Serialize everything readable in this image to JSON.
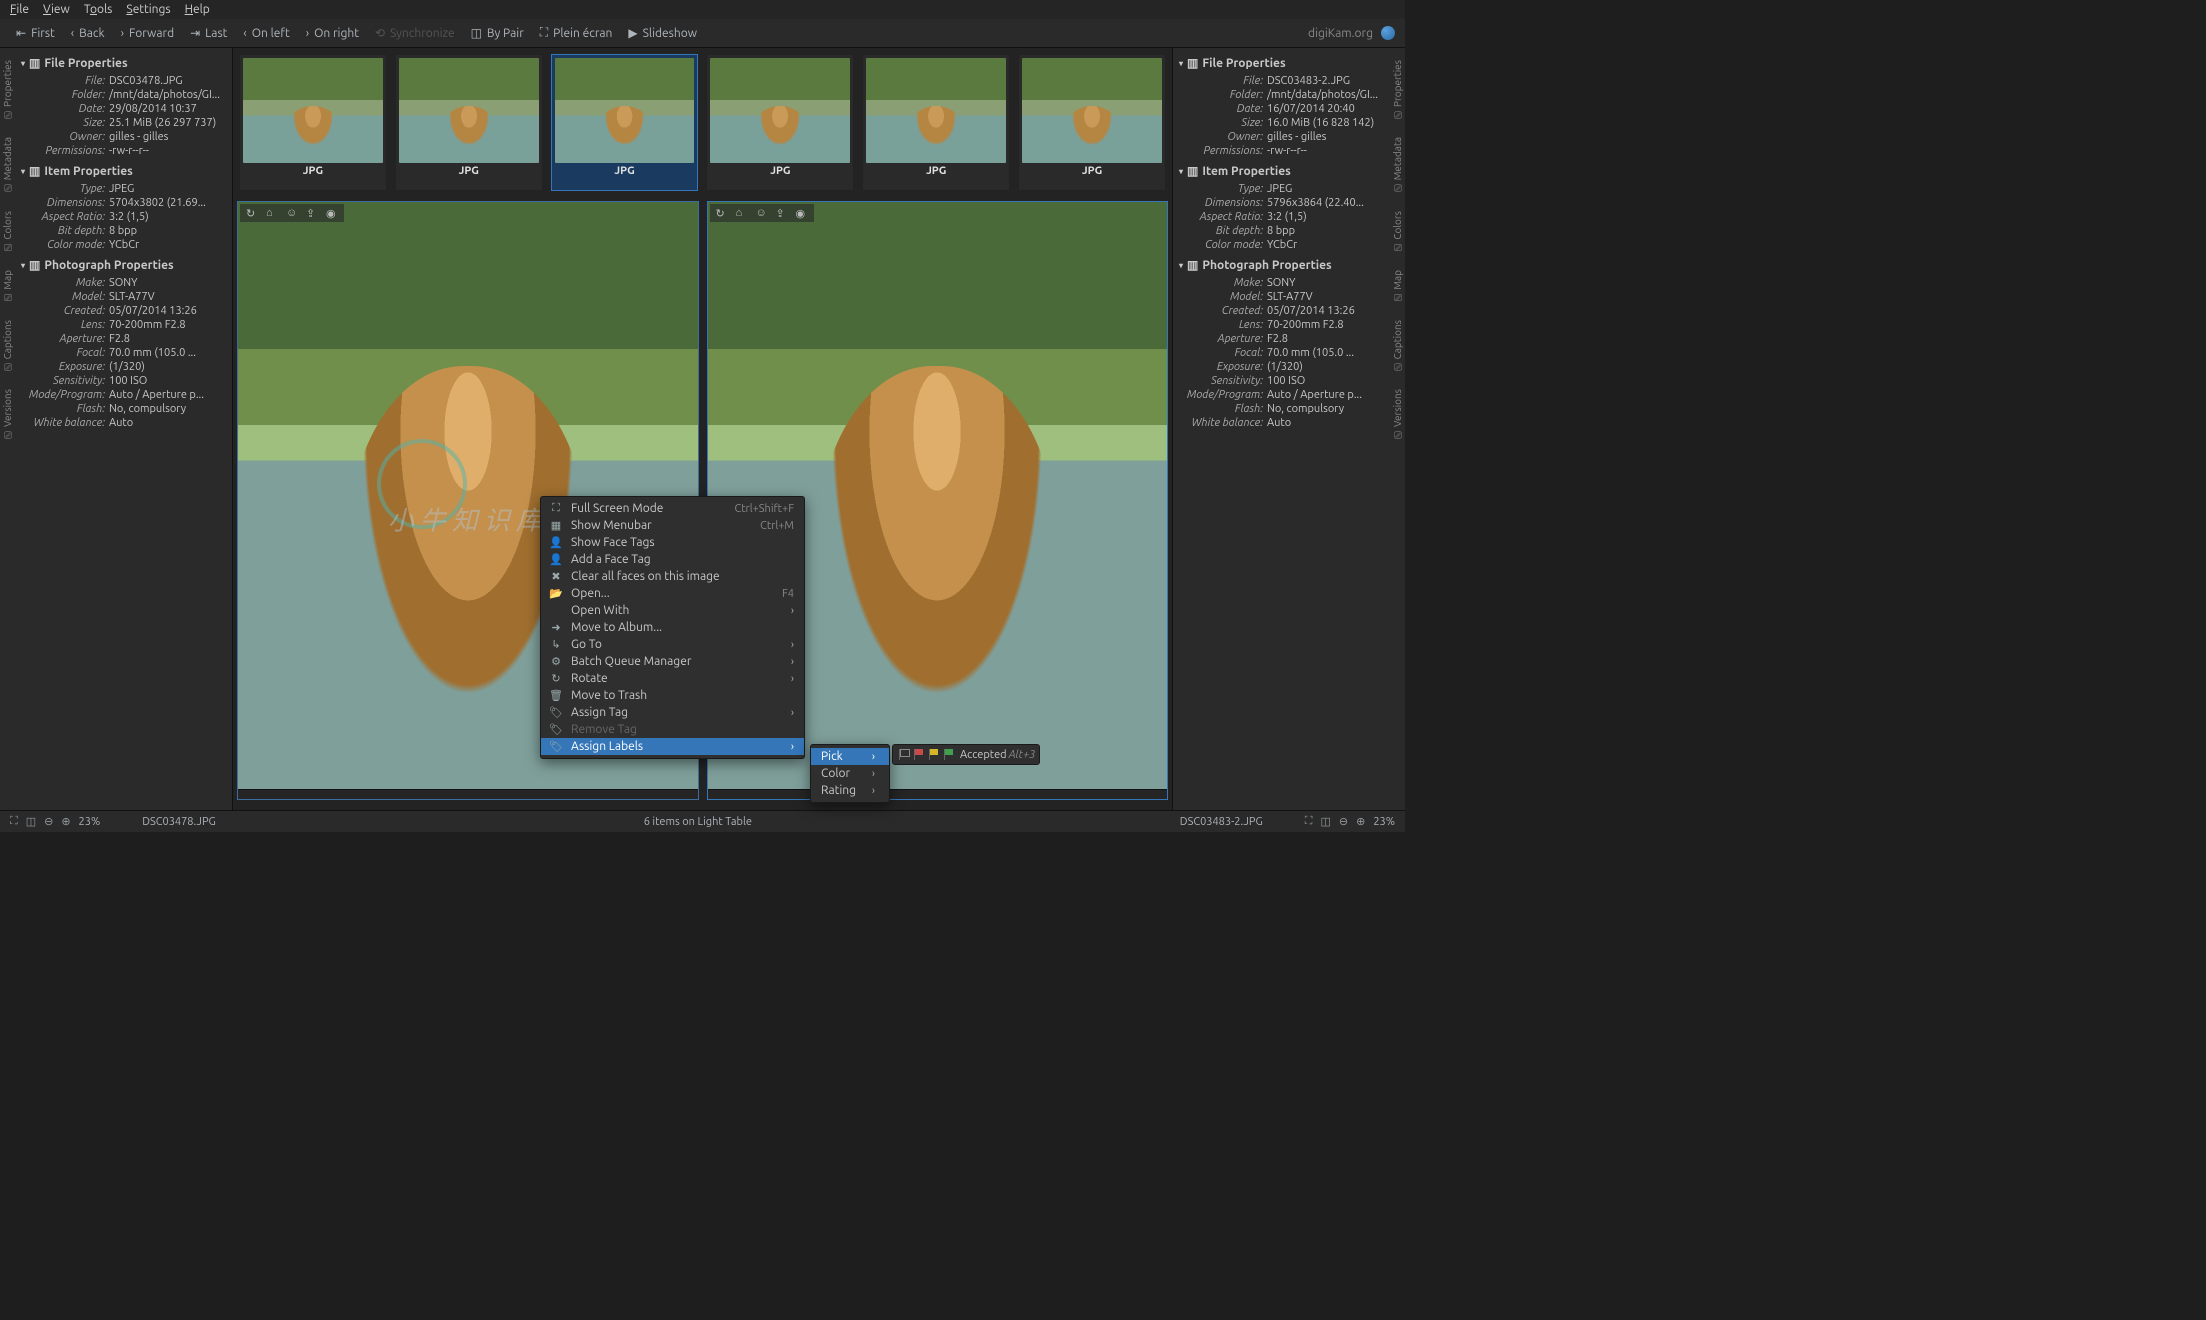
{
  "menubar": {
    "file": "File",
    "view": "View",
    "tools": "Tools",
    "settings": "Settings",
    "help": "Help"
  },
  "toolbar": {
    "first": "First",
    "back": "Back",
    "forward": "Forward",
    "last": "Last",
    "onleft": "On left",
    "onright": "On right",
    "sync": "Synchronize",
    "bypair": "By Pair",
    "fullscreen": "Plein écran",
    "slideshow": "Slideshow",
    "brand": "digiKam.org"
  },
  "thumbnails": {
    "label": "JPG",
    "count": 6
  },
  "left_panel": {
    "file_props": {
      "header": "File Properties",
      "rows": [
        {
          "k": "File:",
          "v": "DSC03478.JPG"
        },
        {
          "k": "Folder:",
          "v": "/mnt/data/photos/GI..."
        },
        {
          "k": "Date:",
          "v": "29/08/2014 10:37"
        },
        {
          "k": "Size:",
          "v": "25.1 MiB (26 297 737)"
        },
        {
          "k": "Owner:",
          "v": "gilles - gilles"
        },
        {
          "k": "Permissions:",
          "v": "-rw-r--r--"
        }
      ]
    },
    "item_props": {
      "header": "Item Properties",
      "rows": [
        {
          "k": "Type:",
          "v": "JPEG"
        },
        {
          "k": "Dimensions:",
          "v": "5704x3802 (21.69..."
        },
        {
          "k": "Aspect Ratio:",
          "v": "3:2 (1,5)"
        },
        {
          "k": "Bit depth:",
          "v": "8 bpp"
        },
        {
          "k": "Color mode:",
          "v": "YCbCr"
        }
      ]
    },
    "photo_props": {
      "header": "Photograph Properties",
      "rows": [
        {
          "k": "Make:",
          "v": "SONY"
        },
        {
          "k": "Model:",
          "v": "SLT-A77V"
        },
        {
          "k": "Created:",
          "v": "05/07/2014 13:26"
        },
        {
          "k": "Lens:",
          "v": "70-200mm F2.8"
        },
        {
          "k": "Aperture:",
          "v": "F2.8"
        },
        {
          "k": "Focal:",
          "v": "70.0 mm (105.0 ..."
        },
        {
          "k": "Exposure:",
          "v": "(1/320)"
        },
        {
          "k": "Sensitivity:",
          "v": "100 ISO"
        },
        {
          "k": "Mode/Program:",
          "v": "Auto / Aperture p..."
        },
        {
          "k": "Flash:",
          "v": "No, compulsory"
        },
        {
          "k": "White balance:",
          "v": "Auto"
        }
      ]
    }
  },
  "right_panel": {
    "file_props": {
      "header": "File Properties",
      "rows": [
        {
          "k": "File:",
          "v": "DSC03483-2.JPG"
        },
        {
          "k": "Folder:",
          "v": "/mnt/data/photos/GI..."
        },
        {
          "k": "Date:",
          "v": "16/07/2014 20:40"
        },
        {
          "k": "Size:",
          "v": "16.0 MiB (16 828 142)"
        },
        {
          "k": "Owner:",
          "v": "gilles - gilles"
        },
        {
          "k": "Permissions:",
          "v": "-rw-r--r--"
        }
      ]
    },
    "item_props": {
      "header": "Item Properties",
      "rows": [
        {
          "k": "Type:",
          "v": "JPEG"
        },
        {
          "k": "Dimensions:",
          "v": "5796x3864 (22.40..."
        },
        {
          "k": "Aspect Ratio:",
          "v": "3:2 (1,5)"
        },
        {
          "k": "Bit depth:",
          "v": "8 bpp"
        },
        {
          "k": "Color mode:",
          "v": "YCbCr"
        }
      ]
    },
    "photo_props": {
      "header": "Photograph Properties",
      "rows": [
        {
          "k": "Make:",
          "v": "SONY"
        },
        {
          "k": "Model:",
          "v": "SLT-A77V"
        },
        {
          "k": "Created:",
          "v": "05/07/2014 13:26"
        },
        {
          "k": "Lens:",
          "v": "70-200mm F2.8"
        },
        {
          "k": "Aperture:",
          "v": "F2.8"
        },
        {
          "k": "Focal:",
          "v": "70.0 mm (105.0 ..."
        },
        {
          "k": "Exposure:",
          "v": "(1/320)"
        },
        {
          "k": "Sensitivity:",
          "v": "100 ISO"
        },
        {
          "k": "Mode/Program:",
          "v": "Auto / Aperture p..."
        },
        {
          "k": "Flash:",
          "v": "No, compulsory"
        },
        {
          "k": "White balance:",
          "v": "Auto"
        }
      ]
    }
  },
  "side_tabs": [
    "Properties",
    "Metadata",
    "Colors",
    "Map",
    "Captions",
    "Versions"
  ],
  "statusbar": {
    "zoom_left": "23%",
    "file_left": "DSC03478.JPG",
    "center": "6 items on Light Table",
    "file_right": "DSC03483-2.JPG",
    "zoom_right": "23%"
  },
  "context_menu": {
    "items": [
      {
        "icon": "⛶",
        "label": "Full Screen Mode",
        "shortcut": "Ctrl+Shift+F"
      },
      {
        "icon": "▦",
        "label": "Show Menubar",
        "shortcut": "Ctrl+M"
      },
      {
        "icon": "👤",
        "label": "Show Face Tags"
      },
      {
        "icon": "👤",
        "label": "Add a Face Tag"
      },
      {
        "icon": "✖",
        "label": "Clear all faces on this image"
      },
      {
        "icon": "📂",
        "label": "Open...",
        "shortcut": "F4"
      },
      {
        "icon": "",
        "label": "Open With",
        "sub": true
      },
      {
        "icon": "➜",
        "label": "Move to Album..."
      },
      {
        "icon": "↳",
        "label": "Go To",
        "sub": true
      },
      {
        "icon": "⚙",
        "label": "Batch Queue Manager",
        "sub": true
      },
      {
        "icon": "↻",
        "label": "Rotate",
        "sub": true
      },
      {
        "icon": "🗑",
        "label": "Move to Trash"
      },
      {
        "icon": "🏷",
        "label": "Assign Tag",
        "sub": true
      },
      {
        "icon": "🏷",
        "label": "Remove Tag",
        "removed": true
      },
      {
        "icon": "🏷",
        "label": "Assign Labels",
        "sub": true,
        "hl": true
      }
    ]
  },
  "submenu_labels": {
    "pick": "Pick",
    "color": "Color",
    "rating": "Rating"
  },
  "flag_popup": {
    "accepted": "Accepted",
    "shortcut": "Alt+3"
  },
  "watermark": "小牛知识库"
}
